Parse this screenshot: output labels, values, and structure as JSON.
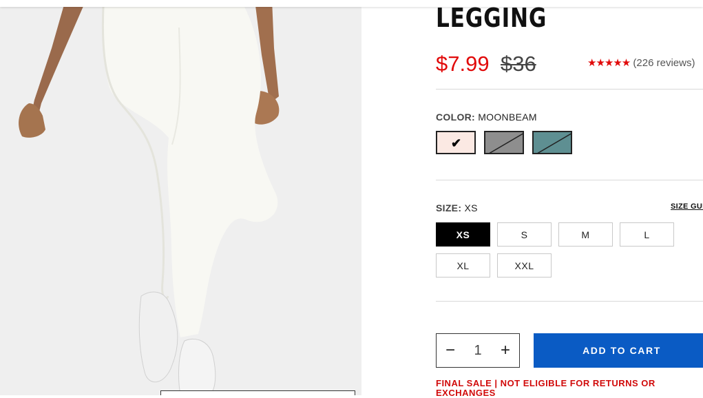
{
  "product": {
    "title": "LEGGING",
    "sale_price": "$7.99",
    "original_price": "$36",
    "rating_stars": "★★★★★",
    "rating_count": "(226 reviews)"
  },
  "color": {
    "label": "COLOR:",
    "selected": "MOONBEAM",
    "swatches": [
      {
        "name": "Moonbeam",
        "hex": "#fbe9e3",
        "available": true,
        "selected": true
      },
      {
        "name": "Grey",
        "hex": "#8e8e8e",
        "available": false,
        "selected": false
      },
      {
        "name": "Teal",
        "hex": "#5e8f92",
        "available": false,
        "selected": false
      }
    ],
    "check_icon": "✔"
  },
  "size": {
    "label": "SIZE:",
    "selected": "XS",
    "guide_label": "SIZE GUIDE",
    "options": [
      "XS",
      "S",
      "M",
      "L",
      "XL",
      "XXL"
    ]
  },
  "quantity": {
    "value": "1",
    "minus": "−",
    "plus": "+"
  },
  "cart": {
    "add_label": "ADD TO CART"
  },
  "notice": {
    "final_sale": "FINAL SALE | NOT ELIGIBLE FOR RETURNS OR EXCHANGES"
  },
  "colors": {
    "sale_red": "#e10a0a",
    "cart_blue": "#0a5bc4",
    "star_red": "#e10a0a"
  }
}
